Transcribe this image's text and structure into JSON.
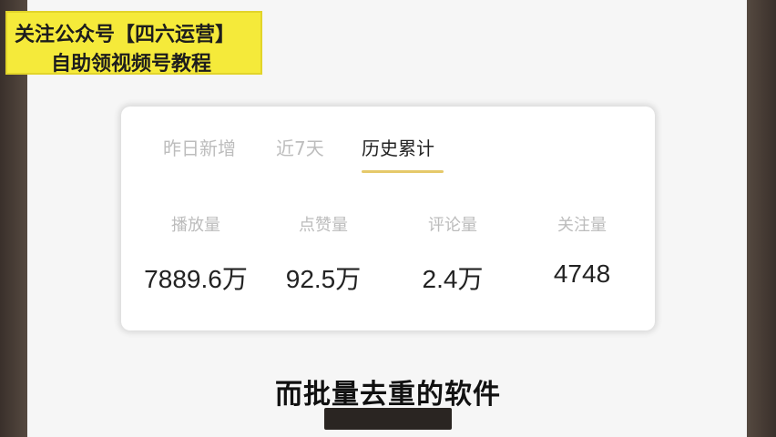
{
  "banner": {
    "line1": "关注公众号【四六运营】",
    "line2": "自助领视频号教程"
  },
  "tabs": [
    {
      "label": "昨日新增",
      "active": false
    },
    {
      "label": "近7天",
      "active": false
    },
    {
      "label": "历史累计",
      "active": true
    }
  ],
  "metrics": [
    {
      "label": "播放量",
      "value": "7889.6万"
    },
    {
      "label": "点赞量",
      "value": "92.5万"
    },
    {
      "label": "评论量",
      "value": "2.4万"
    },
    {
      "label": "关注量",
      "value": "4748"
    }
  ],
  "subtitle": "而批量去重的软件",
  "colors": {
    "banner_bg": "#f5ea3a",
    "active_tab_underline": "#e5c96a",
    "muted_text": "#bdbdbd",
    "frame_bg": "#3e3530"
  }
}
